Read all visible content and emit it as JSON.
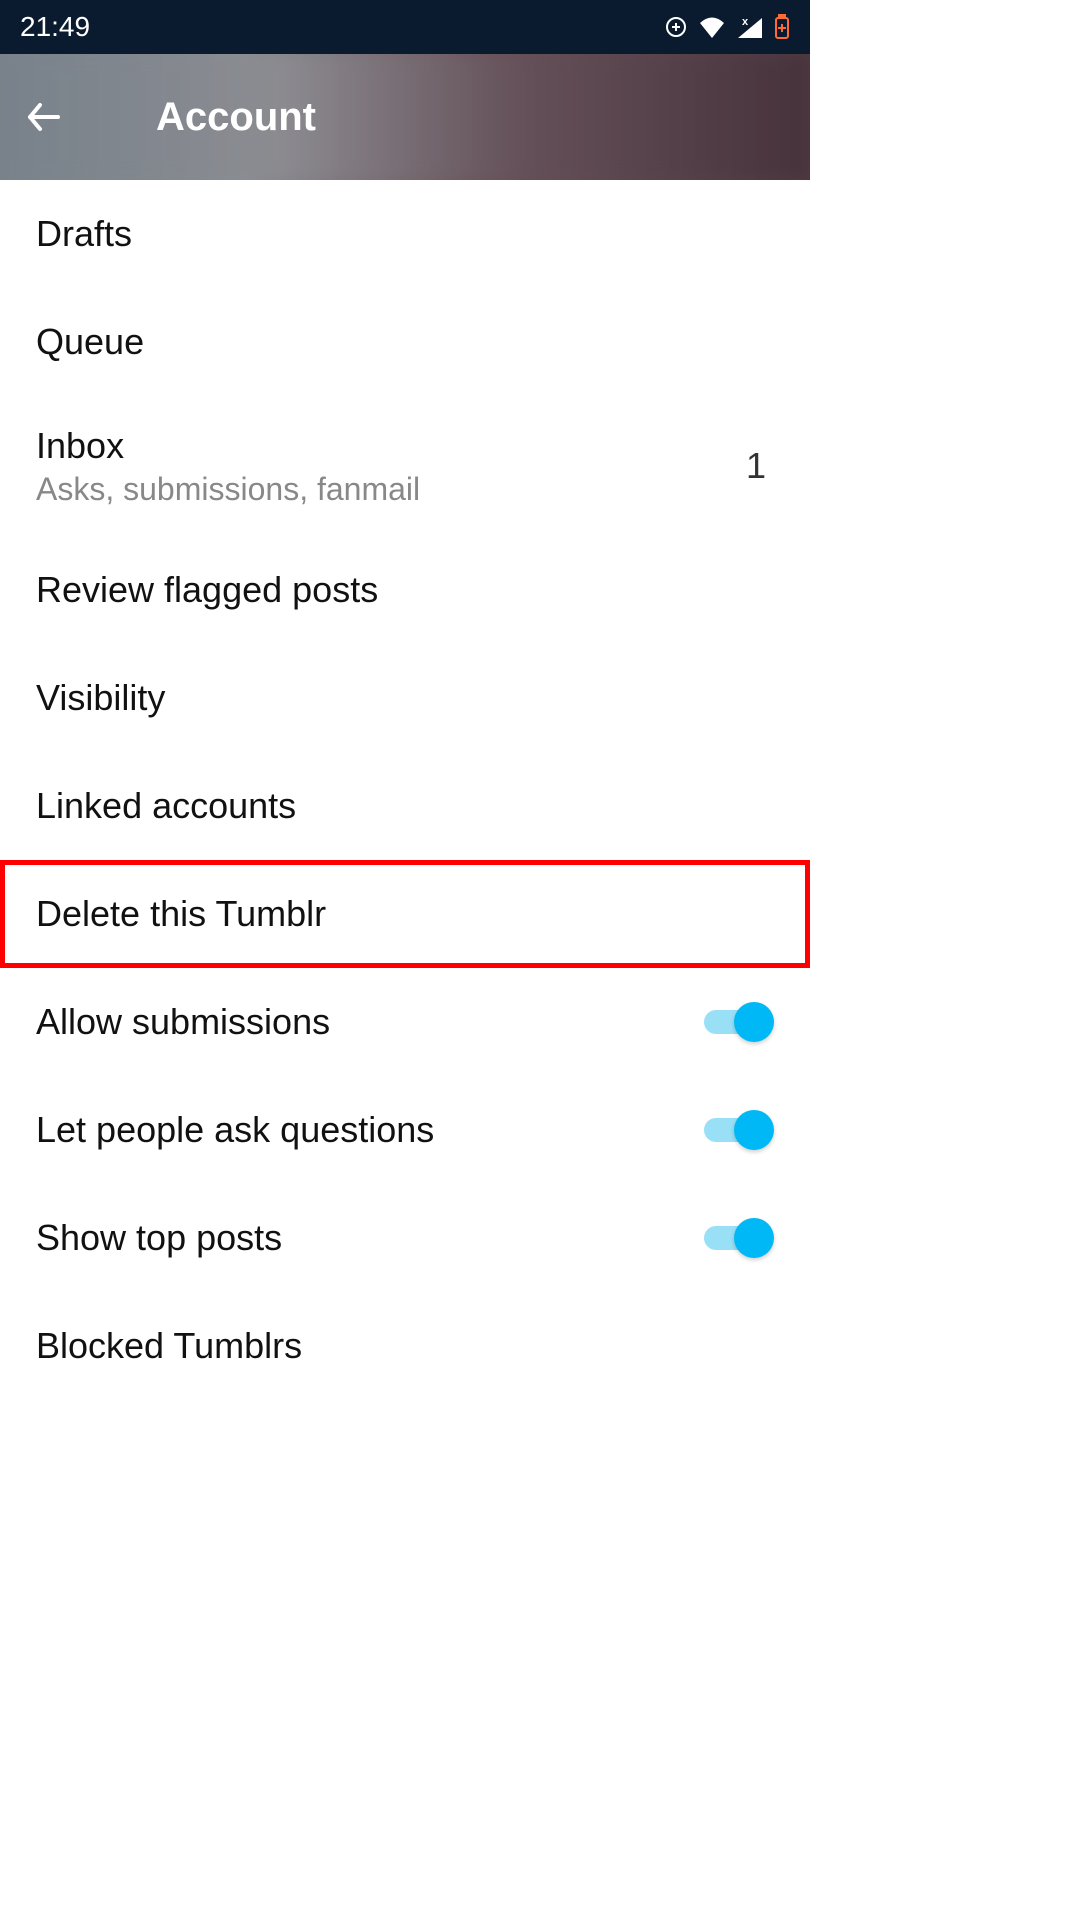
{
  "status": {
    "time": "21:49"
  },
  "header": {
    "title": "Account"
  },
  "items": [
    {
      "label": "Drafts"
    },
    {
      "label": "Queue"
    },
    {
      "label": "Inbox",
      "sublabel": "Asks, submissions, fanmail",
      "count": "1"
    },
    {
      "label": "Review flagged posts"
    },
    {
      "label": "Visibility"
    },
    {
      "label": "Linked accounts"
    },
    {
      "label": "Delete this Tumblr"
    },
    {
      "label": "Allow submissions",
      "toggle": true
    },
    {
      "label": "Let people ask questions",
      "toggle": true
    },
    {
      "label": "Show top posts",
      "toggle": true
    },
    {
      "label": "Blocked Tumblrs"
    }
  ]
}
